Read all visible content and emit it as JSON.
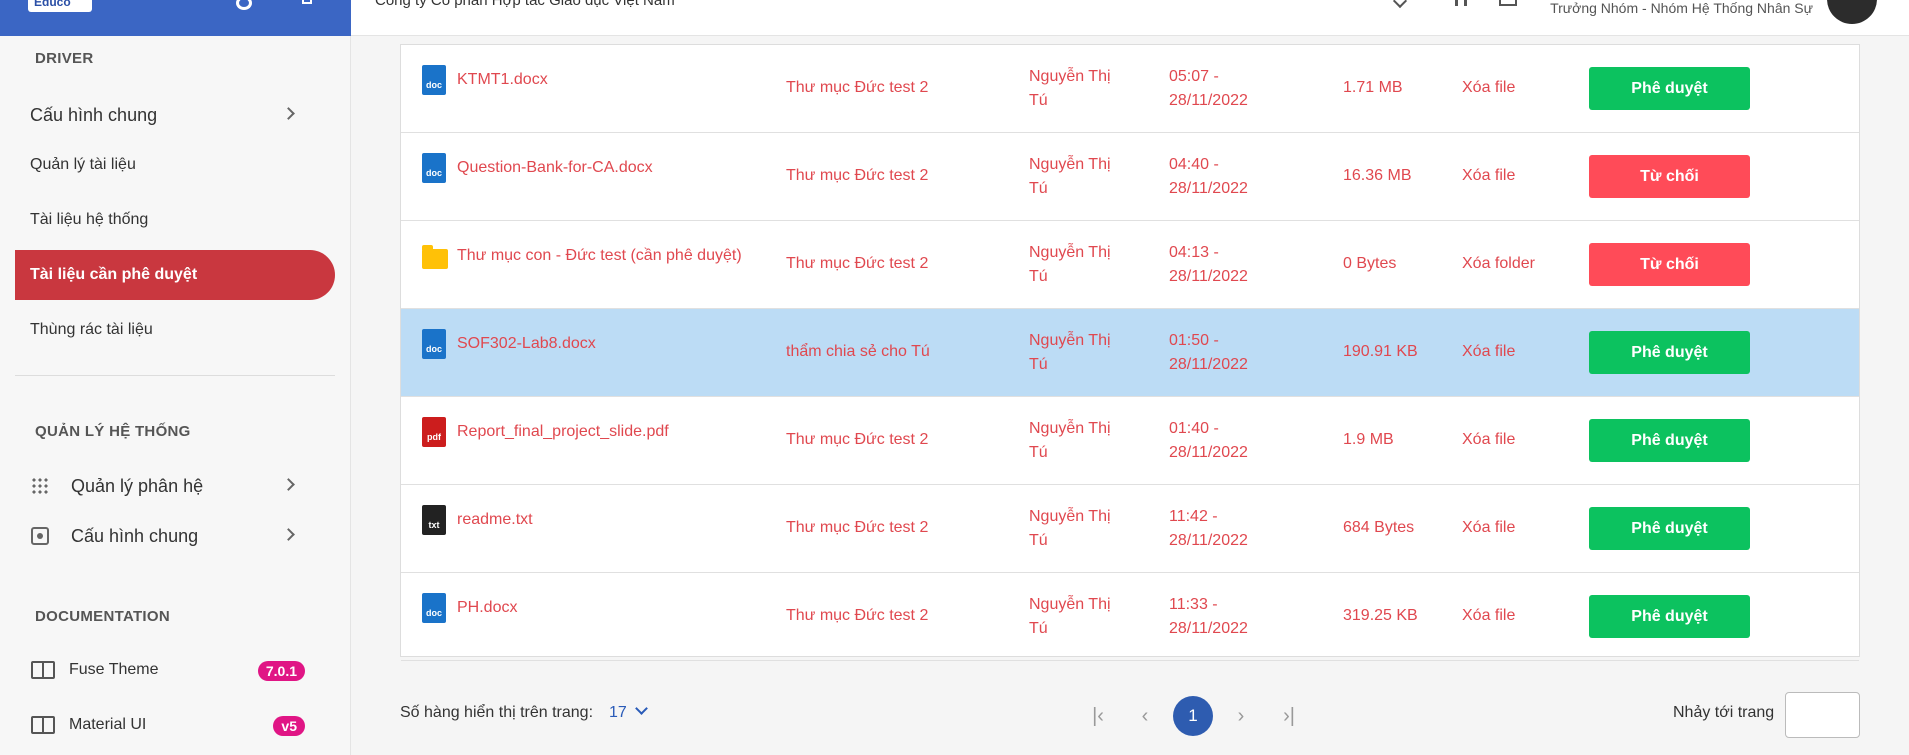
{
  "sidebar": {
    "logo": "Educo",
    "driver_section": "DRIVER",
    "items": [
      {
        "label": "Cấu hình chung"
      },
      {
        "label": "Quản lý tài liệu"
      },
      {
        "label": "Tài liệu hệ thống"
      },
      {
        "label": "Tài liệu cần phê duyệt"
      },
      {
        "label": "Thùng rác tài liệu"
      }
    ],
    "system_section": "QUẢN LÝ HỆ THỐNG",
    "system_items": [
      {
        "label": "Quản lý phân hệ",
        "icon": "grid-icon"
      },
      {
        "label": "Cấu hình chung",
        "icon": "gear-icon"
      }
    ],
    "doc_section": "DOCUMENTATION",
    "doc_items": [
      {
        "label": "Fuse Theme",
        "badge": "7.0.1",
        "icon": "book-icon"
      },
      {
        "label": "Material UI",
        "badge": "v5",
        "icon": "book-icon"
      }
    ]
  },
  "header": {
    "company": "Công ty Cổ phần Hợp tác Giáo dục Việt Nam",
    "user_role": "Trưởng Nhóm - Nhóm Hệ Thống Nhân Sự"
  },
  "table": {
    "rows": [
      {
        "icon": "doc",
        "name": "KTMT1.docx",
        "folder": "Thư mục Đức test 2",
        "owner": "Nguyễn Thị Tú",
        "time1": "05:07 -",
        "time2": "28/11/2022",
        "size": "1.71 MB",
        "action": "Xóa file",
        "button": "Phê duyệt",
        "button_type": "approve"
      },
      {
        "icon": "doc",
        "name": "Question-Bank-for-CA.docx",
        "folder": "Thư mục Đức test 2",
        "owner": "Nguyễn Thị Tú",
        "time1": "04:40 -",
        "time2": "28/11/2022",
        "size": "16.36 MB",
        "action": "Xóa file",
        "button": "Từ chối",
        "button_type": "reject"
      },
      {
        "icon": "folder",
        "name": "Thư mục con - Đức test (cần phê duyệt)",
        "folder": "Thư mục Đức test 2",
        "owner": "Nguyễn Thị Tú",
        "time1": "04:13 -",
        "time2": "28/11/2022",
        "size": "0 Bytes",
        "action": "Xóa folder",
        "button": "Từ chối",
        "button_type": "reject"
      },
      {
        "icon": "doc",
        "name": "SOF302-Lab8.docx",
        "folder": "thẩm chia sẻ cho Tú",
        "owner": "Nguyễn Thị Tú",
        "time1": "01:50 -",
        "time2": "28/11/2022",
        "size": "190.91 KB",
        "action": "Xóa file",
        "button": "Phê duyệt",
        "button_type": "approve"
      },
      {
        "icon": "pdf",
        "name": "Report_final_project_slide.pdf",
        "folder": "Thư mục Đức test 2",
        "owner": "Nguyễn Thị Tú",
        "time1": "01:40 -",
        "time2": "28/11/2022",
        "size": "1.9 MB",
        "action": "Xóa file",
        "button": "Phê duyệt",
        "button_type": "approve"
      },
      {
        "icon": "txt",
        "name": "readme.txt",
        "folder": "Thư mục Đức test 2",
        "owner": "Nguyễn Thị Tú",
        "time1": "11:42 -",
        "time2": "28/11/2022",
        "size": "684 Bytes",
        "action": "Xóa file",
        "button": "Phê duyệt",
        "button_type": "approve"
      },
      {
        "icon": "doc",
        "name": "PH.docx",
        "folder": "Thư mục Đức test 2",
        "owner": "Nguyễn Thị Tú",
        "time1": "11:33 -",
        "time2": "28/11/2022",
        "size": "319.25 KB",
        "action": "Xóa file",
        "button": "Phê duyệt",
        "button_type": "approve"
      }
    ],
    "selected_row": 3
  },
  "pager": {
    "rows_label": "Số hàng hiển thị trên trang:",
    "rows_value": "17",
    "current_page": "1",
    "jump_label": "Nhảy tới trang"
  },
  "colors": {
    "accent": "#c9373f",
    "approve": "#0cc25f",
    "reject": "#ff4b58",
    "link": "#e0484f",
    "selected": "#bcdcf5"
  }
}
